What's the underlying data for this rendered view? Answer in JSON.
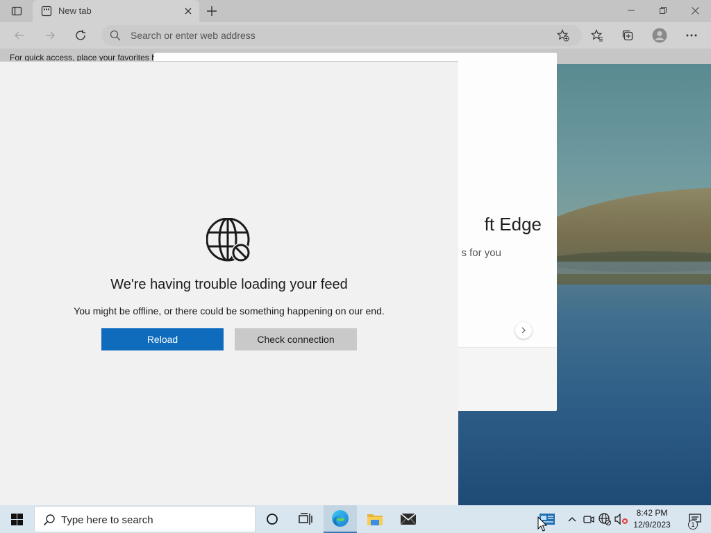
{
  "browser": {
    "tab": {
      "title": "New tab"
    },
    "address_bar": {
      "placeholder": "Search or enter web address"
    },
    "favorites_bar": {
      "text": "For quick access, place your favorites h"
    }
  },
  "welcome_card": {
    "title_fragment": "ft Edge",
    "subtitle_fragment": "s for you"
  },
  "feed_error": {
    "title": "We're having trouble loading your feed",
    "message": "You might be offline, or there could be something happening on our end.",
    "reload_label": "Reload",
    "check_connection_label": "Check connection"
  },
  "taskbar": {
    "search_placeholder": "Type here to search",
    "clock": {
      "time": "8:42 PM",
      "date": "12/9/2023"
    },
    "notification_count": "1"
  },
  "colors": {
    "accent": "#0f6cbd",
    "panel_bg": "#f1f1f1",
    "taskbar_bg": "#d9e5ef"
  },
  "icons": [
    "tab-actions-icon",
    "new-tab-page-icon",
    "close-icon",
    "plus-icon",
    "minimize-icon",
    "restore-icon",
    "window-close-icon",
    "back-arrow-icon",
    "forward-arrow-icon",
    "refresh-icon",
    "search-icon",
    "add-favorite-icon",
    "favorites-icon",
    "collections-icon",
    "profile-icon",
    "more-options-icon",
    "globe-blocked-icon",
    "chevron-right-icon",
    "windows-logo-icon",
    "cortana-icon",
    "task-view-icon",
    "edge-icon",
    "file-explorer-icon",
    "mail-icon",
    "news-icon",
    "chevron-up-icon",
    "meet-now-icon",
    "network-icon",
    "volume-muted-icon",
    "action-center-icon"
  ]
}
